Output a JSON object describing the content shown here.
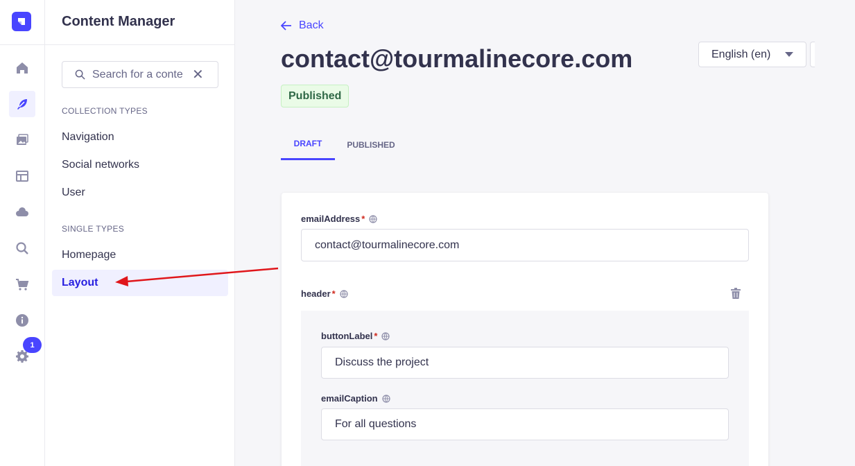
{
  "subnav": {
    "title": "Content Manager",
    "search_placeholder": "Search for a conte",
    "collection_types_label": "COLLECTION TYPES",
    "collection_types": [
      "Navigation",
      "Social networks",
      "User"
    ],
    "single_types_label": "SINGLE TYPES",
    "single_types": [
      "Homepage",
      "Layout"
    ],
    "active_item": "Layout"
  },
  "rail": {
    "icons": [
      "home-icon",
      "feather-icon",
      "media-library-icon",
      "layout-icon",
      "cloud-icon",
      "search-icon",
      "cart-icon",
      "info-icon",
      "settings-icon"
    ],
    "notification_count": "1"
  },
  "header": {
    "back_label": "Back",
    "title": "contact@tourmalinecore.com",
    "status": "Published",
    "locale": "English (en)"
  },
  "tabs": [
    {
      "label": "DRAFT",
      "active": true
    },
    {
      "label": "PUBLISHED",
      "active": false
    }
  ],
  "form": {
    "emailAddress": {
      "label": "emailAddress",
      "value": "contact@tourmalinecore.com"
    },
    "header": {
      "label": "header"
    },
    "buttonLabel": {
      "label": "buttonLabel",
      "value": "Discuss the project"
    },
    "emailCaption": {
      "label": "emailCaption",
      "value": "For all questions"
    },
    "required_marker": "*"
  },
  "colors": {
    "accent": "#4945ff",
    "published_bg": "#eafbe7",
    "published_text": "#2f6846",
    "required": "#d02b20",
    "annotation_arrow": "#e0161b"
  }
}
